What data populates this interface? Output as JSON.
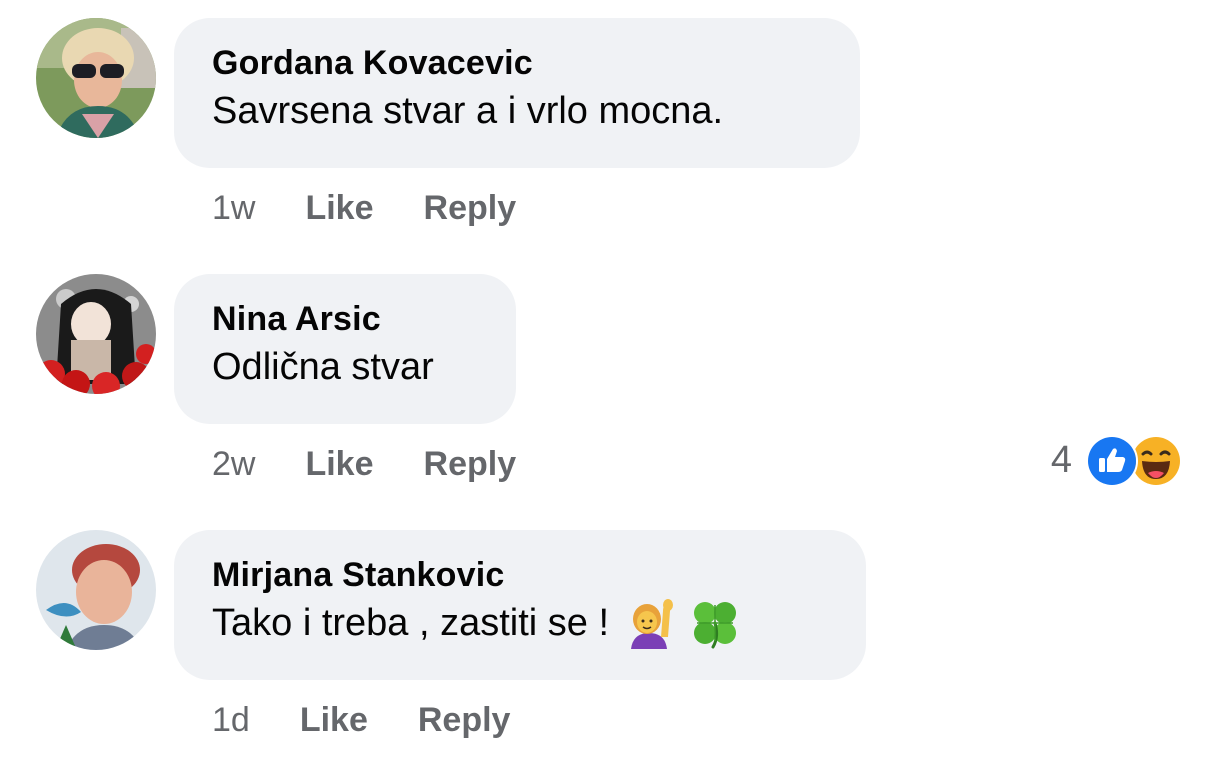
{
  "comments": [
    {
      "author": "Gordana Kovacevic",
      "text": "Savrsena stvar a i vrlo mocna.",
      "time": "1w",
      "like_label": "Like",
      "reply_label": "Reply"
    },
    {
      "author": "Nina Arsic",
      "text": "Odlična stvar",
      "time": "2w",
      "like_label": "Like",
      "reply_label": "Reply",
      "reaction_count": "4",
      "reaction_icons": [
        "like-icon",
        "haha-icon"
      ]
    },
    {
      "author": "Mirjana Stankovic",
      "text": "Tako i treba , zastiti se !",
      "emojis": [
        "person-raising-hand-icon",
        "four-leaf-clover-icon"
      ],
      "time": "1d",
      "like_label": "Like",
      "reply_label": "Reply"
    }
  ],
  "colors": {
    "bubble_background": "#f0f2f5",
    "secondary_text": "#65676b",
    "primary_text": "#050505",
    "like_blue": "#1877f2",
    "haha_yellow": "#f7b125"
  }
}
